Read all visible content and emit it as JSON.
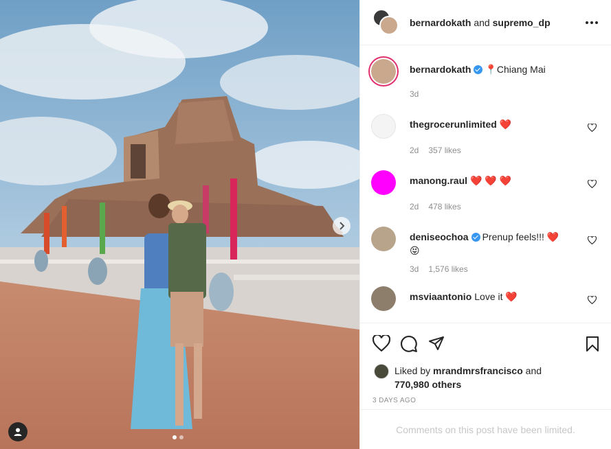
{
  "header": {
    "user_primary": "bernardokath",
    "connector": " and ",
    "user_secondary": "supremo_dp",
    "more_icon": "more-horizontal-icon"
  },
  "caption": {
    "username": "bernardokath",
    "location_pin": "📍",
    "text": "Chiang Mai",
    "age": "3d"
  },
  "comments": [
    {
      "username": "thegrocerunlimited",
      "text": "",
      "emoji": "❤️",
      "age": "2d",
      "likes": "357 likes",
      "avatar_color": "#f4f4f4"
    },
    {
      "username": "manong.raul",
      "text": "",
      "emoji": "❤️ ❤️ ❤️",
      "age": "2d",
      "likes": "478 likes",
      "avatar_color": "#ff00ff"
    },
    {
      "username": "deniseochoa",
      "text": "Prenup feels!!!",
      "emoji": "❤️",
      "emoji2": "😝",
      "age": "3d",
      "likes": "1,576 likes",
      "avatar_color": "#b8a48a"
    },
    {
      "username": "msviaantonio",
      "text": "Love it",
      "emoji": "❤️",
      "age": "",
      "likes": "",
      "avatar_color": "#8c7e6a"
    }
  ],
  "liked_by": {
    "prefix": "Liked by ",
    "user": "mrandmrsfrancisco",
    "suffix": " and",
    "others": "770,980 others"
  },
  "post_date": "3 DAYS AGO",
  "comments_limited": "Comments on this post have been limited.",
  "colors": {
    "accent": "#3897f0",
    "heart": "#e02a3b",
    "muted": "#8e8e8e"
  }
}
